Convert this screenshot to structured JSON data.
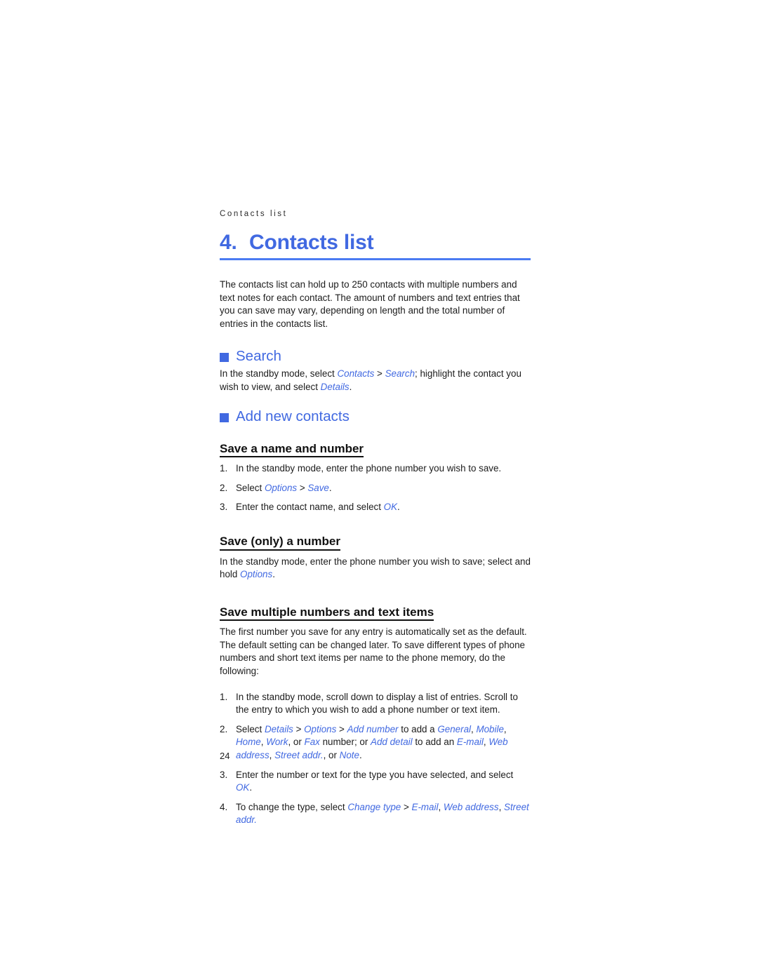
{
  "page": {
    "running_header": "Contacts list",
    "folio": "24",
    "accent_color": "#4169e1",
    "rule_color": "#4a7bf2",
    "text_color": "#1c1c1c"
  },
  "chapter": {
    "number": "4.",
    "title": "Contacts list"
  },
  "intro": {
    "paragraph": "The contacts list can hold up to 250 contacts with multiple numbers and text notes for each contact. The amount of numbers and text entries that you can save may vary, depending on length and the total number of entries in the contacts list."
  },
  "sections": [
    {
      "id": "search",
      "heading": "Search",
      "bullet_icon": "square-bullet-icon",
      "paragraph_parts": [
        {
          "t": "In the standby mode, select ",
          "style": "plain"
        },
        {
          "t": "Contacts",
          "style": "ui"
        },
        {
          "t": " > ",
          "style": "plain"
        },
        {
          "t": "Search",
          "style": "ui"
        },
        {
          "t": "; highlight the contact you wish to view, and select ",
          "style": "plain"
        },
        {
          "t": "Details",
          "style": "ui"
        },
        {
          "t": ".",
          "style": "plain"
        }
      ]
    },
    {
      "id": "add-new-contacts",
      "heading": "Add new contacts",
      "bullet_icon": "square-bullet-icon",
      "subsections": [
        {
          "id": "save-a-name-and-number",
          "heading": "Save a name and number",
          "steps": [
            {
              "num": "1.",
              "parts": [
                {
                  "t": "In the standby mode, enter the phone number you wish to save.",
                  "style": "plain"
                }
              ]
            },
            {
              "num": "2.",
              "parts": [
                {
                  "t": "Select ",
                  "style": "plain"
                },
                {
                  "t": "Options",
                  "style": "ui"
                },
                {
                  "t": " > ",
                  "style": "plain"
                },
                {
                  "t": "Save",
                  "style": "ui"
                },
                {
                  "t": ".",
                  "style": "plain"
                }
              ]
            },
            {
              "num": "3.",
              "parts": [
                {
                  "t": "Enter the contact name, and select ",
                  "style": "plain"
                },
                {
                  "t": "OK",
                  "style": "ui"
                },
                {
                  "t": ".",
                  "style": "plain"
                }
              ]
            }
          ]
        },
        {
          "id": "save-only-a-number",
          "heading": "Save (only) a number",
          "paragraph_parts": [
            {
              "t": "In the standby mode, enter the phone number you wish to save; select and hold ",
              "style": "plain"
            },
            {
              "t": "Options",
              "style": "ui"
            },
            {
              "t": ".",
              "style": "plain"
            }
          ]
        },
        {
          "id": "save-multiple-numbers-and-text-items",
          "heading": "Save multiple numbers and text items",
          "paragraph": "The first number you save for any entry is automatically set as the default. The default setting can be changed later. To save different types of phone numbers and short text items per name to the phone memory, do the following:",
          "steps": [
            {
              "num": "1.",
              "parts": [
                {
                  "t": "In the standby mode, scroll down to display a list of entries. Scroll to the entry to which you wish to add a phone number or text item.",
                  "style": "plain"
                }
              ]
            },
            {
              "num": "2.",
              "parts": [
                {
                  "t": "Select ",
                  "style": "plain"
                },
                {
                  "t": "Details",
                  "style": "ui"
                },
                {
                  "t": " > ",
                  "style": "plain"
                },
                {
                  "t": "Options",
                  "style": "ui"
                },
                {
                  "t": " > ",
                  "style": "plain"
                },
                {
                  "t": "Add number",
                  "style": "ui"
                },
                {
                  "t": " to add a ",
                  "style": "plain"
                },
                {
                  "t": "General",
                  "style": "ui"
                },
                {
                  "t": ", ",
                  "style": "plain"
                },
                {
                  "t": "Mobile",
                  "style": "ui"
                },
                {
                  "t": ", ",
                  "style": "plain"
                },
                {
                  "t": "Home",
                  "style": "ui"
                },
                {
                  "t": ", ",
                  "style": "plain"
                },
                {
                  "t": "Work",
                  "style": "ui"
                },
                {
                  "t": ", or ",
                  "style": "plain"
                },
                {
                  "t": "Fax",
                  "style": "ui"
                },
                {
                  "t": " number; or ",
                  "style": "plain"
                },
                {
                  "t": "Add detail",
                  "style": "ui"
                },
                {
                  "t": " to add an ",
                  "style": "plain"
                },
                {
                  "t": "E-mail",
                  "style": "ui"
                },
                {
                  "t": ", ",
                  "style": "plain"
                },
                {
                  "t": "Web address",
                  "style": "ui"
                },
                {
                  "t": ", ",
                  "style": "plain"
                },
                {
                  "t": "Street addr.",
                  "style": "ui"
                },
                {
                  "t": ", or ",
                  "style": "plain"
                },
                {
                  "t": "Note",
                  "style": "ui"
                },
                {
                  "t": ".",
                  "style": "plain"
                }
              ]
            },
            {
              "num": "3.",
              "parts": [
                {
                  "t": "Enter the number or text for the type you have selected, and select ",
                  "style": "plain"
                },
                {
                  "t": "OK",
                  "style": "ui"
                },
                {
                  "t": ".",
                  "style": "plain"
                }
              ]
            },
            {
              "num": "4.",
              "parts": [
                {
                  "t": "To change the type, select ",
                  "style": "plain"
                },
                {
                  "t": "Change type",
                  "style": "ui"
                },
                {
                  "t": " > ",
                  "style": "plain"
                },
                {
                  "t": "E-mail",
                  "style": "ui"
                },
                {
                  "t": ", ",
                  "style": "plain"
                },
                {
                  "t": "Web address",
                  "style": "ui"
                },
                {
                  "t": ", ",
                  "style": "plain"
                },
                {
                  "t": "Street addr.",
                  "style": "ui"
                }
              ]
            }
          ]
        }
      ]
    }
  ]
}
